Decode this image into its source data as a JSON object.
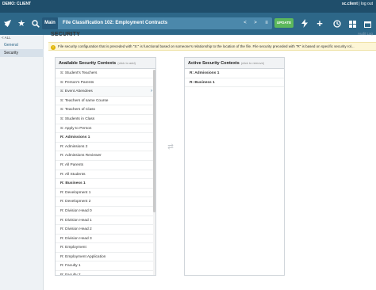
{
  "topbar": {
    "client": "DEMO: CLIENT",
    "user_name": "sc.client",
    "user_sep": " | ",
    "logout": "log out"
  },
  "nav": {
    "icons": [
      "rocket-icon",
      "star-icon",
      "search-icon"
    ],
    "main_label": "Main",
    "context_title": "File Classification 102: Employment Contracts",
    "prev_label": "<",
    "next_label": ">",
    "list_label": "≡",
    "update_label": "UPDATE",
    "right_icons": [
      "lightning-icon",
      "plus-icon",
      "history-icon",
      "grid-icon",
      "calendar-icon"
    ]
  },
  "sidebar": {
    "all_label": "< ALL",
    "items": [
      {
        "label": "General",
        "active": false
      },
      {
        "label": "Security",
        "active": true
      }
    ]
  },
  "page": {
    "title": "SECURITY",
    "help": "Audit Log",
    "info": "File security configuration that is preceded with \"S:\" is functional based on someone's relationship to the location of the file.  File security preceded with \"R\" is based on specific security rol..."
  },
  "available": {
    "title": "Available Security Contexts",
    "hint": "(click to add)",
    "items": [
      {
        "label": "S: Student's Teachers",
        "bold": false
      },
      {
        "label": "S: Person's Parents",
        "bold": false
      },
      {
        "label": "S: Event Attendees",
        "bold": false,
        "hover": true
      },
      {
        "label": "S: Teachers of same Course",
        "bold": false
      },
      {
        "label": "S: Teachers of Class",
        "bold": false
      },
      {
        "label": "S: Students in Class",
        "bold": false
      },
      {
        "label": "S: Apply to Person",
        "bold": false
      },
      {
        "label": "R: Admissions 1",
        "bold": true
      },
      {
        "label": "R: Admissions 2",
        "bold": false
      },
      {
        "label": "R: Admissions Reviewer",
        "bold": false
      },
      {
        "label": "R: All Parents",
        "bold": false
      },
      {
        "label": "R: All Students",
        "bold": false
      },
      {
        "label": "R: Business 1",
        "bold": true
      },
      {
        "label": "R: Development 1",
        "bold": false
      },
      {
        "label": "R: Development 2",
        "bold": false
      },
      {
        "label": "R: Division Head 0",
        "bold": false
      },
      {
        "label": "R: Division Head 1",
        "bold": false
      },
      {
        "label": "R: Division Head 2",
        "bold": false
      },
      {
        "label": "R: Division Head 3",
        "bold": false
      },
      {
        "label": "R: Employment",
        "bold": false
      },
      {
        "label": "R: Employment Application",
        "bold": false
      },
      {
        "label": "R: Faculty 1",
        "bold": false
      },
      {
        "label": "R: Faculty 2",
        "bold": false
      }
    ]
  },
  "active": {
    "title": "Active Security Contexts",
    "hint": "(click to remove)",
    "items": [
      {
        "label": "R: Admissions 1"
      },
      {
        "label": "R: Business 1"
      }
    ]
  }
}
